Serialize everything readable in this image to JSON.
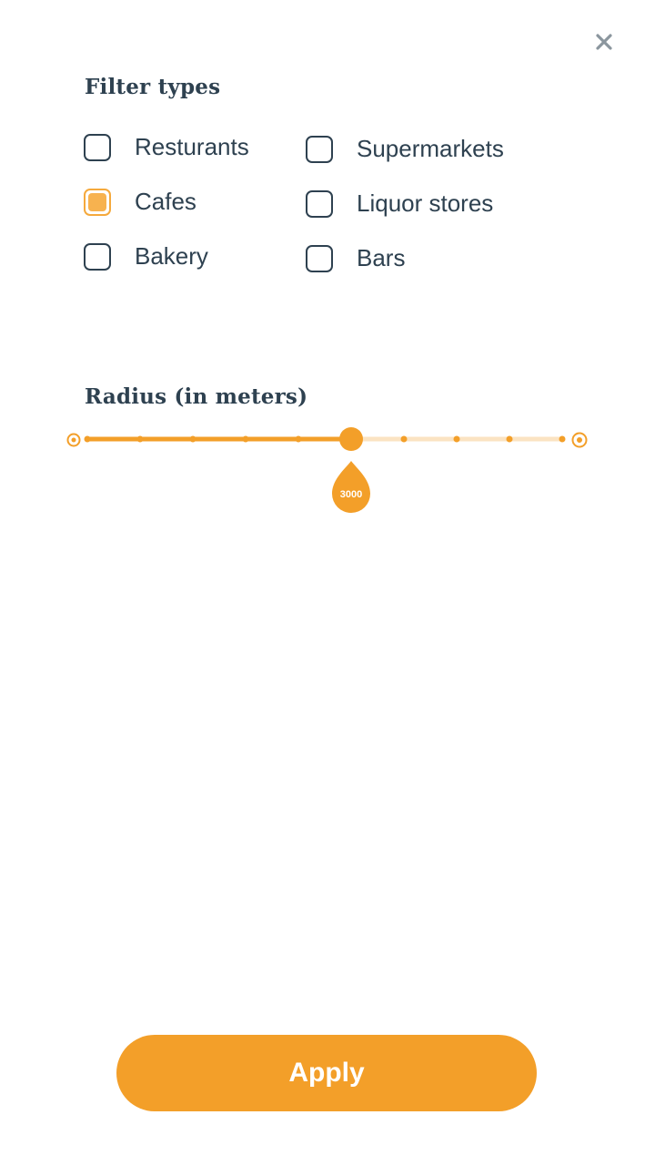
{
  "close": {
    "icon": "close-icon"
  },
  "filter": {
    "title": "Filter types",
    "items": [
      {
        "label": "Resturants",
        "checked": false
      },
      {
        "label": "Supermarkets",
        "checked": false
      },
      {
        "label": "Cafes",
        "checked": true
      },
      {
        "label": "Liquor stores",
        "checked": false
      },
      {
        "label": "Bakery",
        "checked": false
      },
      {
        "label": "Bars",
        "checked": false
      }
    ]
  },
  "radius": {
    "title": "Radius (in meters)",
    "value_label": "3000",
    "value": 3000,
    "step_count": 10,
    "selected_step": 5,
    "colors": {
      "active": "#f39f29",
      "inactive": "#fbe3c2"
    }
  },
  "apply": {
    "label": "Apply",
    "color": "#f39f29"
  }
}
